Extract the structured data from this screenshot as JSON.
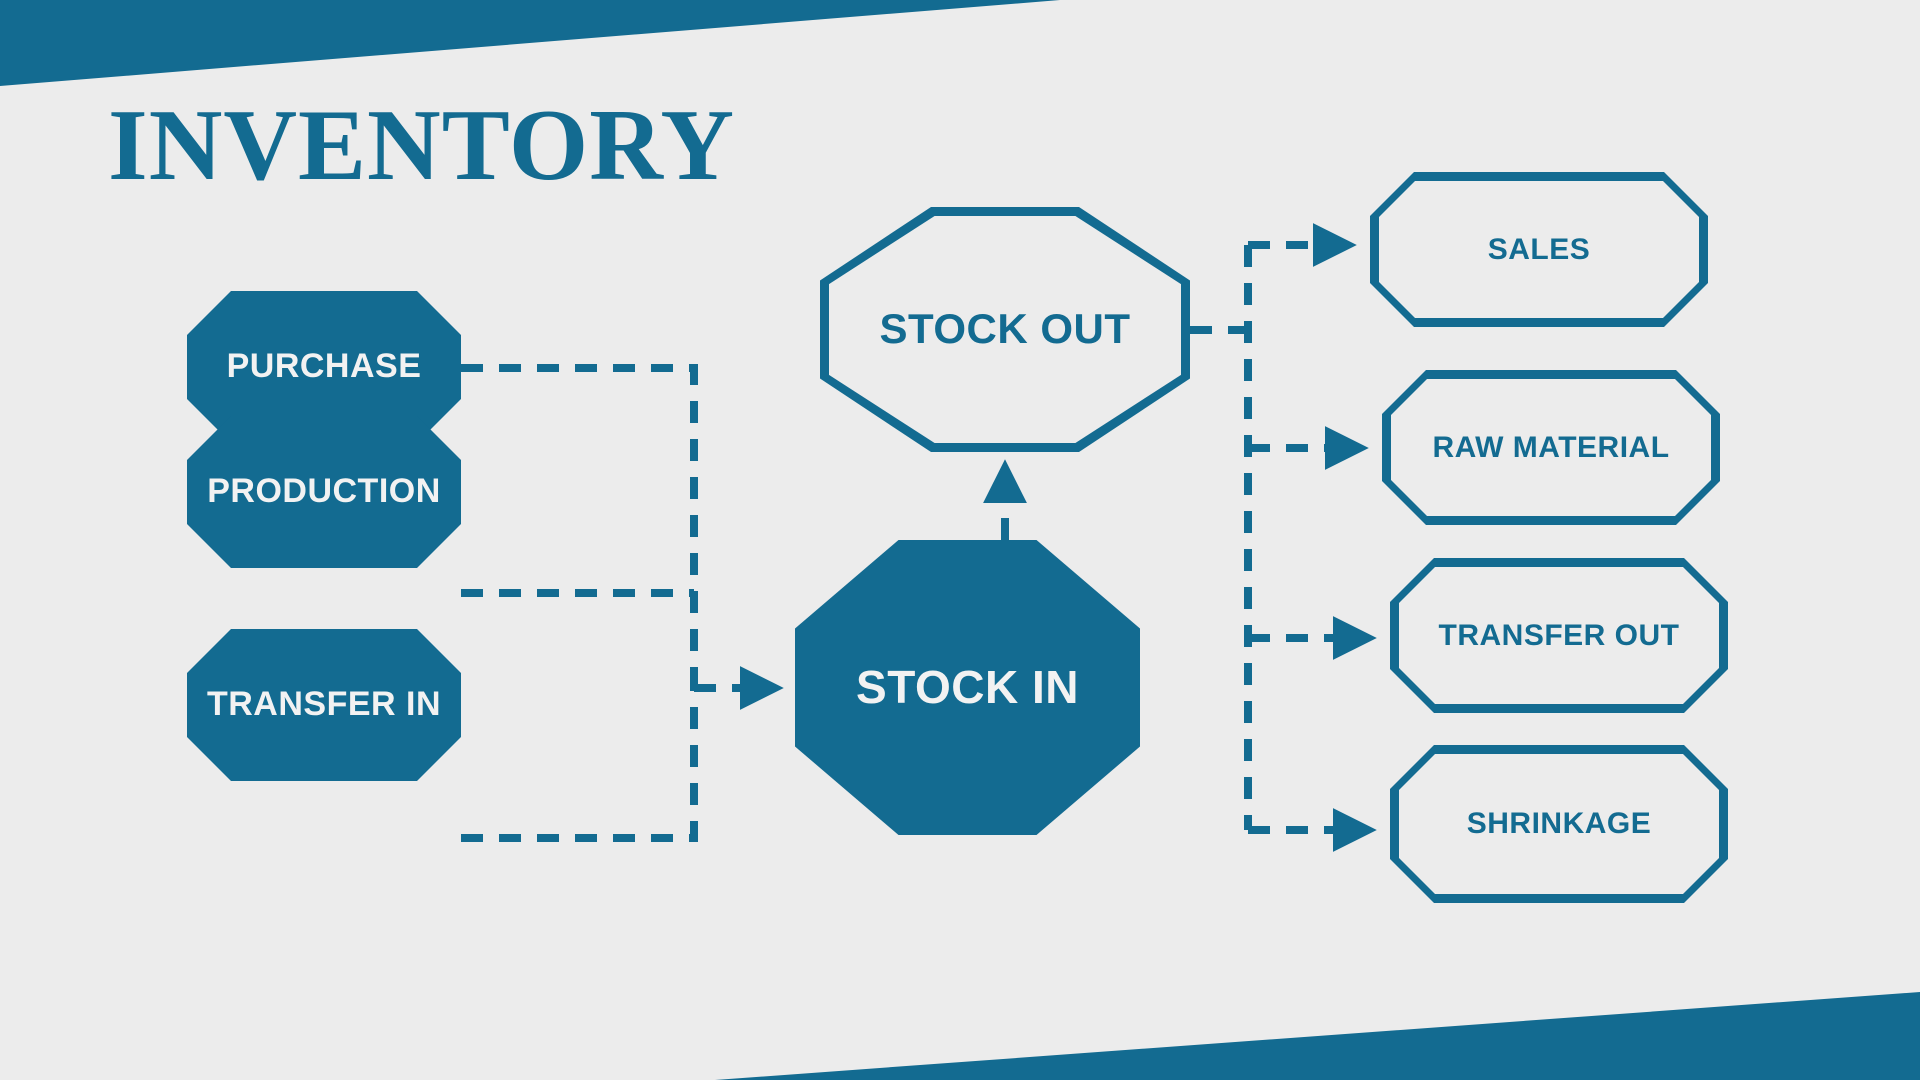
{
  "title": "INVENTORY",
  "theme": {
    "brand_blue": "#136B91",
    "background": "#ECECEC"
  },
  "banners": {
    "top_label": "top-angled-banner",
    "bottom_label": "bottom-angled-banner"
  },
  "nodes": {
    "inputs": [
      {
        "id": "purchase",
        "label": "PURCHASE"
      },
      {
        "id": "production",
        "label": "PRODUCTION"
      },
      {
        "id": "transfer_in",
        "label": "TRANSFER IN"
      }
    ],
    "hub_in": {
      "id": "stock_in",
      "label": "STOCK IN"
    },
    "hub_out": {
      "id": "stock_out",
      "label": "STOCK OUT"
    },
    "outputs": [
      {
        "id": "sales",
        "label": "SALES"
      },
      {
        "id": "raw_material",
        "label": "RAW MATERIAL"
      },
      {
        "id": "transfer_out",
        "label": "TRANSFER OUT"
      },
      {
        "id": "shrinkage",
        "label": "SHRINKAGE"
      }
    ]
  },
  "edges": [
    {
      "from": "purchase",
      "to": "stock_in",
      "style": "dashed"
    },
    {
      "from": "production",
      "to": "stock_in",
      "style": "dashed"
    },
    {
      "from": "transfer_in",
      "to": "stock_in",
      "style": "dashed"
    },
    {
      "from": "stock_in",
      "to": "stock_out",
      "style": "dashed"
    },
    {
      "from": "stock_out",
      "to": "sales",
      "style": "dashed"
    },
    {
      "from": "stock_out",
      "to": "raw_material",
      "style": "dashed"
    },
    {
      "from": "stock_out",
      "to": "transfer_out",
      "style": "dashed"
    },
    {
      "from": "stock_out",
      "to": "shrinkage",
      "style": "dashed"
    }
  ]
}
